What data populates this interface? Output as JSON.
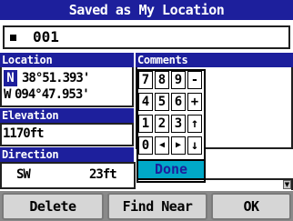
{
  "title": "Saved as My Location",
  "name": {
    "value": "001"
  },
  "location": {
    "header": "Location",
    "lat_dir": "N",
    "lat_value": "38°51.393'",
    "lon_dir": "W",
    "lon_value": "094°47.953'"
  },
  "comments": {
    "header": "Comments"
  },
  "elevation": {
    "header": "Elevation",
    "value": "1170ft"
  },
  "direction": {
    "header": "Direction",
    "bearing": "SW",
    "distance": "23ft"
  },
  "keypad": {
    "rows": [
      [
        "7",
        "8",
        "9",
        "-"
      ],
      [
        "4",
        "5",
        "6",
        "+"
      ],
      [
        "1",
        "2",
        "3",
        "↑"
      ],
      [
        "0",
        "◀",
        "▶",
        "↓"
      ]
    ],
    "done": "Done"
  },
  "buttons": {
    "delete": "Delete",
    "find_near": "Find Near",
    "ok": "OK"
  },
  "colors": {
    "header_bg": "#1d1f9c",
    "highlight": "#00a8c8",
    "button_bar": "#8a8a8a"
  }
}
